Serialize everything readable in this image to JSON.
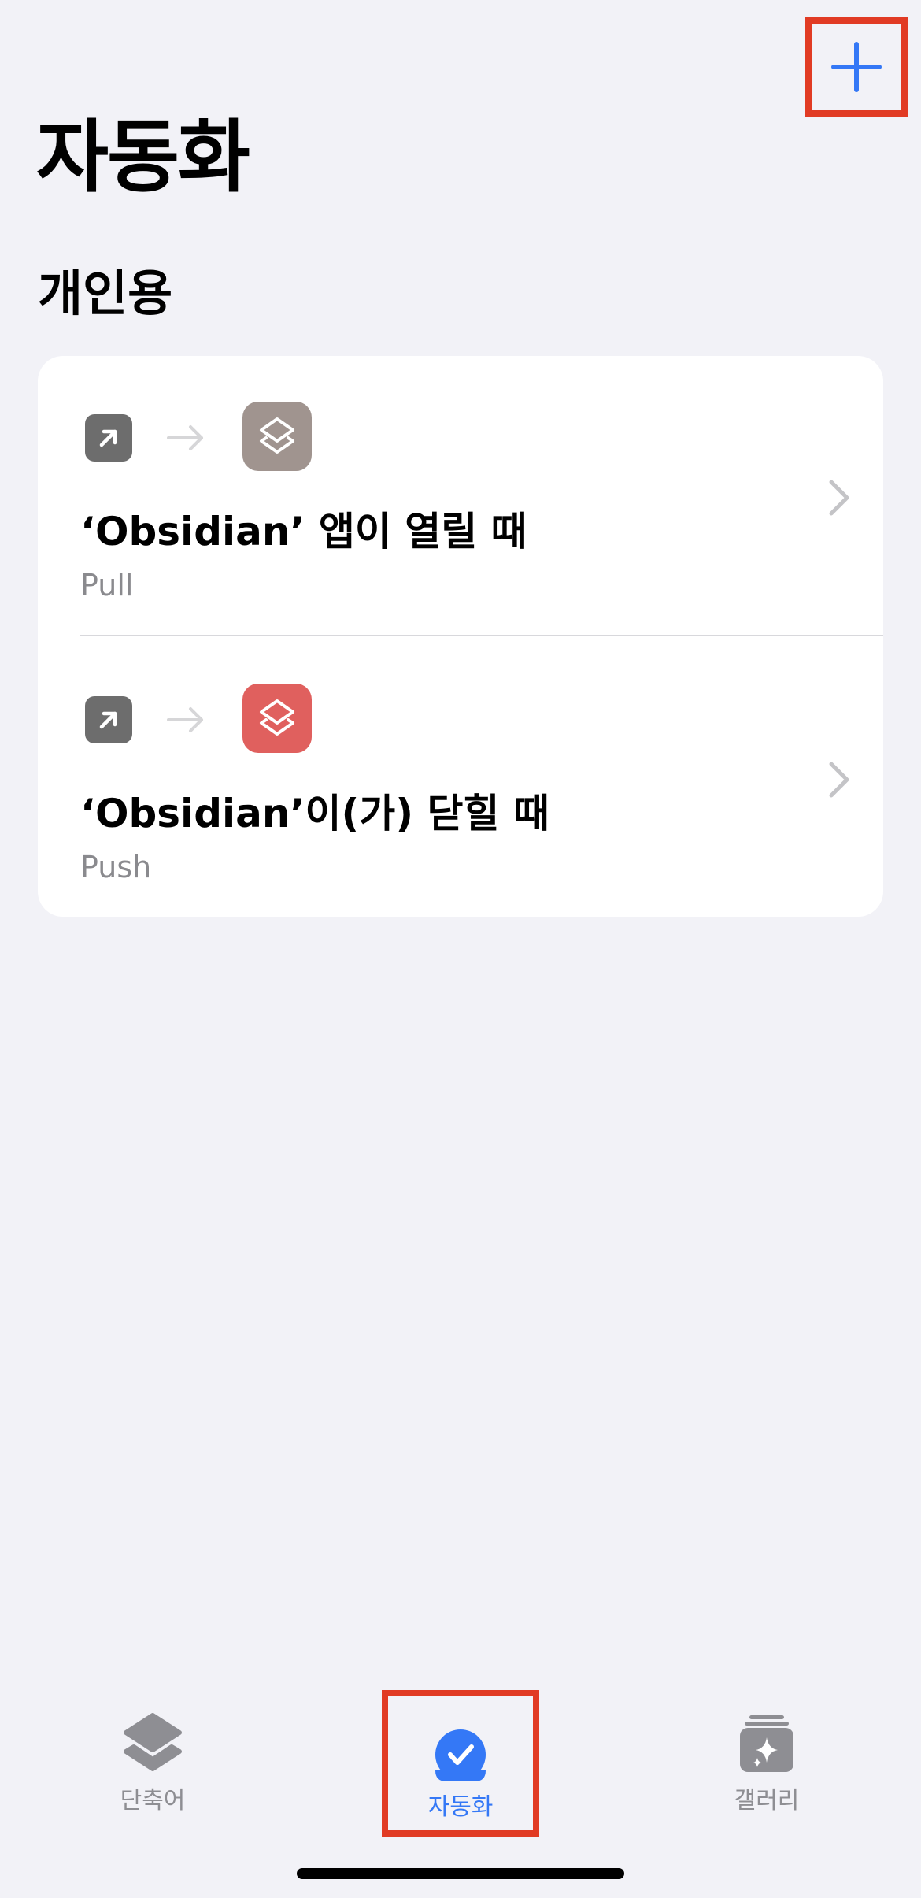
{
  "header": {
    "add_button": "plus-icon",
    "title": "자동화"
  },
  "section": {
    "title": "개인용"
  },
  "automations": [
    {
      "title": "‘Obsidian’ 앱이 열릴 때",
      "subtitle": "Pull",
      "trigger_icon": "open-app-icon",
      "shortcut_icon_color": "#a0948f"
    },
    {
      "title": "‘Obsidian’이(가) 닫힐 때",
      "subtitle": "Push",
      "trigger_icon": "open-app-icon",
      "shortcut_icon_color": "#e0605e"
    }
  ],
  "tabbar": {
    "tabs": [
      {
        "label": "단축어",
        "icon": "shortcuts-icon",
        "selected": false
      },
      {
        "label": "자동화",
        "icon": "automation-icon",
        "selected": true
      },
      {
        "label": "갤러리",
        "icon": "gallery-icon",
        "selected": false
      }
    ]
  },
  "colors": {
    "accent": "#3478f6",
    "highlight_border": "#e13b24",
    "background": "#f2f2f7"
  }
}
